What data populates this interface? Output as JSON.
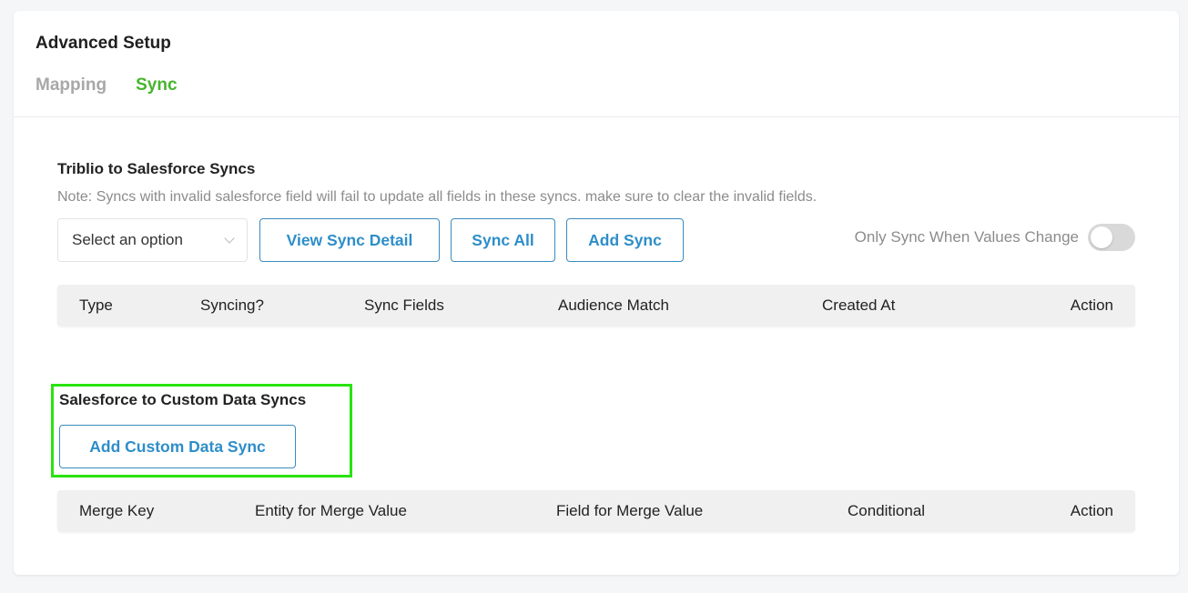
{
  "header": {
    "title": "Advanced Setup",
    "tabs": [
      {
        "label": "Mapping",
        "active": false
      },
      {
        "label": "Sync",
        "active": true
      }
    ]
  },
  "salesforce_syncs": {
    "title": "Triblio to Salesforce Syncs",
    "note": "Note: Syncs with invalid salesforce field will fail to update all fields in these syncs. make sure to clear the invalid fields.",
    "select_value": "Select an option",
    "view_detail_label": "View Sync Detail",
    "sync_all_label": "Sync All",
    "add_sync_label": "Add Sync",
    "toggle_label": "Only Sync When Values Change",
    "toggle_on": false,
    "columns": [
      "Type",
      "Syncing?",
      "Sync Fields",
      "Audience Match",
      "Created At",
      "Action"
    ]
  },
  "custom_data_syncs": {
    "title": "Salesforce to Custom Data Syncs",
    "add_label": "Add Custom Data Sync",
    "columns": [
      "Merge Key",
      "Entity for Merge Value",
      "Field for Merge Value",
      "Conditional",
      "Action"
    ]
  },
  "colors": {
    "accent_green": "#46b52d",
    "button_blue": "#2e8ec9",
    "highlight_green": "#29e30f"
  },
  "icons": {
    "select_chevron": "chevron-down-icon"
  }
}
